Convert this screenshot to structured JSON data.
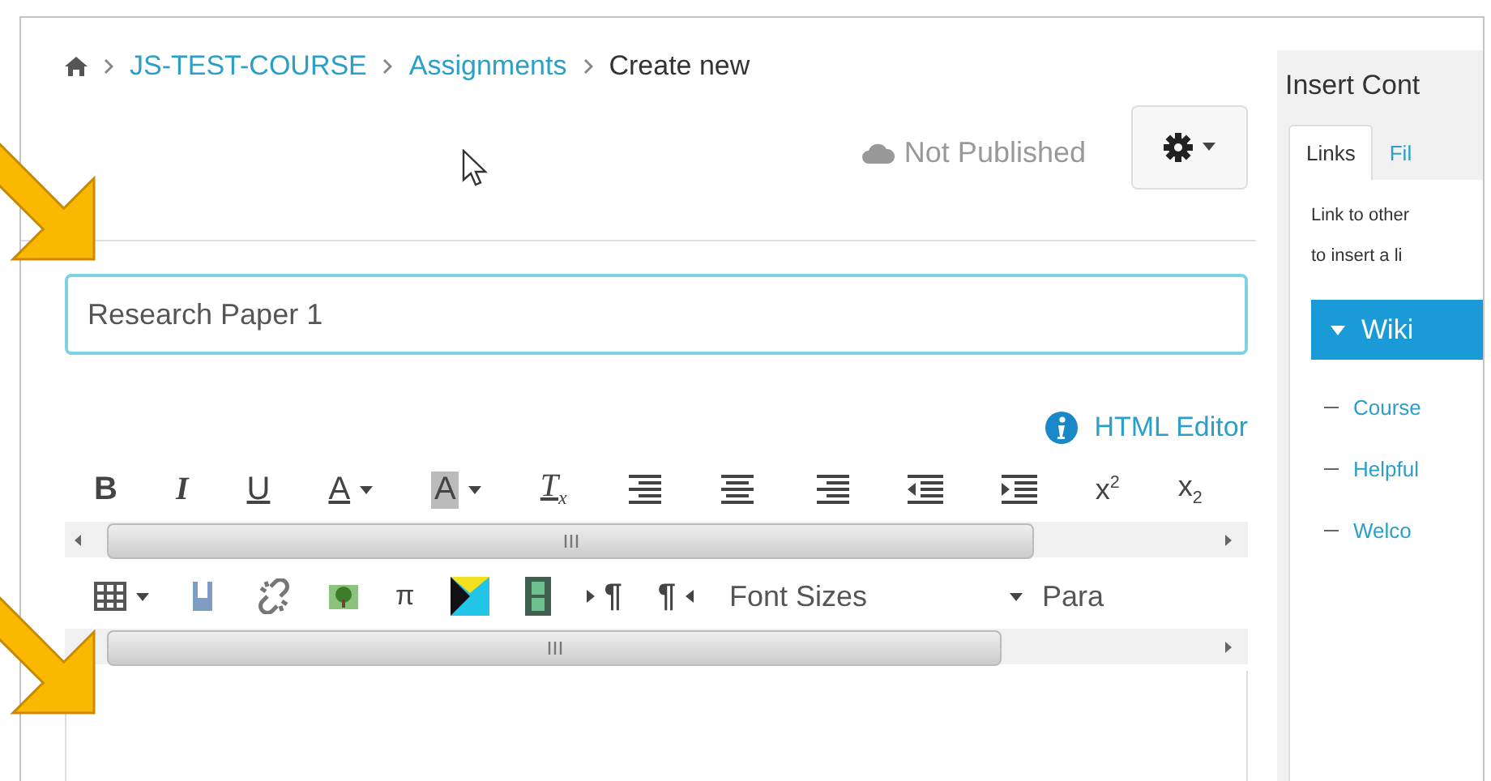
{
  "breadcrumb": [
    {
      "label": "JS-TEST-COURSE",
      "kind": "link"
    },
    {
      "label": "Assignments",
      "kind": "link"
    },
    {
      "label": "Create new",
      "kind": "current"
    }
  ],
  "status": "Not Published",
  "title_field": {
    "value": "Research Paper 1"
  },
  "html_editor_link": "HTML Editor",
  "toolbar_rows": [
    {
      "has_left_arrow": true,
      "items": [
        {
          "kind": "bold",
          "label": "B"
        },
        {
          "kind": "italic",
          "label": "I"
        },
        {
          "kind": "underline",
          "label": "U"
        },
        {
          "kind": "text-color",
          "label": "A",
          "dropdown": true
        },
        {
          "kind": "bg-color",
          "label": "A",
          "dropdown": true
        },
        {
          "kind": "clear-format",
          "label": "T$_{x}$"
        },
        {
          "kind": "align-left"
        },
        {
          "kind": "align-center"
        },
        {
          "kind": "align-right"
        },
        {
          "kind": "outdent"
        },
        {
          "kind": "indent"
        },
        {
          "kind": "script",
          "label": "x$^{2}$"
        },
        {
          "kind": "script",
          "label": "x$_{2}$"
        }
      ]
    },
    {
      "has_left_arrow": false,
      "items": [
        {
          "kind": "table",
          "dropdown": true
        },
        {
          "kind": "tool"
        },
        {
          "kind": "unlink"
        },
        {
          "kind": "image"
        },
        {
          "kind": "symbol",
          "label": "π"
        },
        {
          "kind": "media"
        },
        {
          "kind": "film"
        },
        {
          "kind": "ltr",
          "label": "¶"
        },
        {
          "kind": "rtl",
          "label": "¶"
        },
        {
          "kind": "select",
          "label": "Font Sizes",
          "dropdown": true
        },
        {
          "kind": "select",
          "label": "Para"
        }
      ]
    }
  ],
  "insert_panel": {
    "title": "Insert Cont",
    "tabs": [
      {
        "label": "Links",
        "selected": true
      },
      {
        "label": "Fil",
        "selected": false
      }
    ],
    "description_lines": [
      "Link to other",
      "to insert a li"
    ],
    "section": {
      "label": "Wiki",
      "expanded": true
    },
    "items": [
      "Course",
      "Helpful",
      "Welco"
    ]
  }
}
